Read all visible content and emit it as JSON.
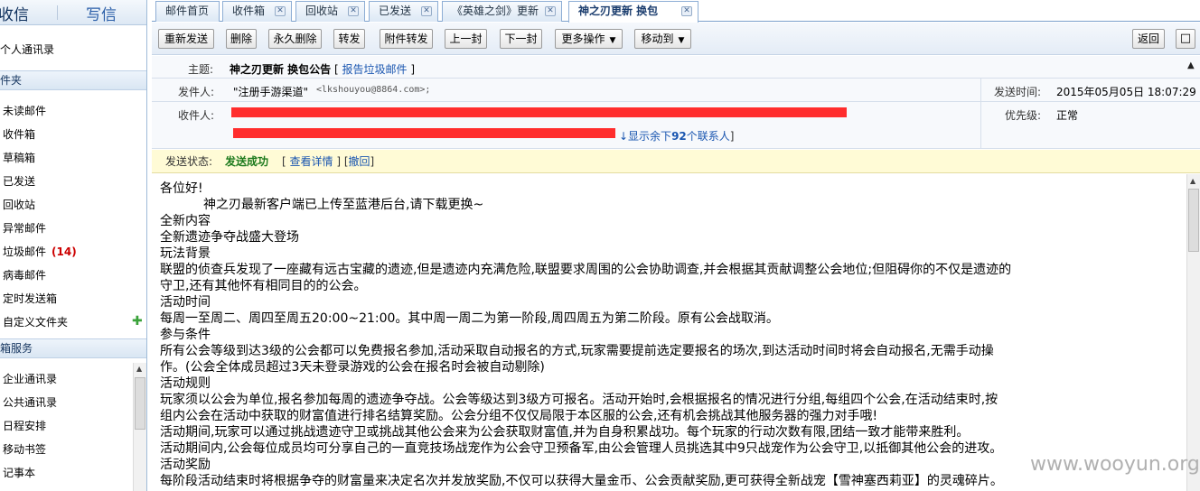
{
  "sidebar": {
    "receive": "收信",
    "write": "写信",
    "contacts": "个人通讯录",
    "folders_header": "件夹",
    "folders": [
      {
        "label": "未读邮件"
      },
      {
        "label": "收件箱"
      },
      {
        "label": "草稿箱"
      },
      {
        "label": "已发送"
      },
      {
        "label": "回收站"
      },
      {
        "label": "异常邮件"
      },
      {
        "label": "垃圾邮件",
        "count": "(14)"
      },
      {
        "label": "病毒邮件"
      },
      {
        "label": "定时发送箱"
      },
      {
        "label": "自定义文件夹"
      }
    ],
    "services_header": "箱服务",
    "services": [
      {
        "label": "企业通讯录"
      },
      {
        "label": "公共通讯录"
      },
      {
        "label": "日程安排"
      },
      {
        "label": "移动书签"
      },
      {
        "label": "记事本"
      }
    ]
  },
  "tabs": [
    {
      "label": "邮件首页"
    },
    {
      "label": "收件箱"
    },
    {
      "label": "回收站"
    },
    {
      "label": "已发送"
    },
    {
      "label": "《英雄之剑》更新"
    },
    {
      "label": "神之刃更新 换包"
    }
  ],
  "toolbar": {
    "resend": "重新发送",
    "delete": "删除",
    "delete_forever": "永久删除",
    "forward": "转发",
    "forward_attachment": "附件转发",
    "prev": "上一封",
    "next": "下一封",
    "more": "更多操作",
    "move": "移动到",
    "back": "返回"
  },
  "header": {
    "subject_label": "主题:",
    "subject": "神之刃更新 换包公告",
    "report": "报告垃圾邮件",
    "sender_label": "发件人:",
    "sender_name": "\"注册手游渠道\"",
    "sender_email": "<lkshouyou@8864.com>;",
    "time_label": "发送时间:",
    "time": "2015年05月05日 18:07:29",
    "recipient_label": "收件人:",
    "priority_label": "优先级:",
    "priority": "正常",
    "show_more_prefix": "↓显示余下",
    "show_more_count": "92",
    "show_more_suffix": "个联系人"
  },
  "status": {
    "label": "发送状态:",
    "value": "发送成功",
    "detail": "查看详情",
    "undo": "撤回"
  },
  "body": {
    "lines": [
      "各位好!",
      "神之刃最新客户端已上传至蓝港后台,请下载更换~",
      "全新内容",
      "全新遗迹争夺战盛大登场",
      "玩法背景",
      "联盟的侦查兵发现了一座藏有远古宝藏的遗迹,但是遗迹内充满危险,联盟要求周围的公会协助调查,并会根据其贡献调整公会地位;但阻碍你的不仅是遗迹的",
      "守卫,还有其他怀有相同目的的公会。",
      "活动时间",
      "每周一至周二、周四至周五20:00~21:00。其中周一周二为第一阶段,周四周五为第二阶段。原有公会战取消。",
      "参与条件",
      "所有公会等级到达3级的公会都可以免费报名参加,活动采取自动报名的方式,玩家需要提前选定要报名的场次,到达活动时间时将会自动报名,无需手动操",
      "作。(公会全体成员超过3天未登录游戏的公会在报名时会被自动剔除)",
      "活动规则",
      "玩家须以公会为单位,报名参加每周的遗迹争夺战。公会等级达到3级方可报名。活动开始时,会根据报名的情况进行分组,每组四个公会,在活动结束时,按",
      "组内公会在活动中获取的财富值进行排名结算奖励。公会分组不仅仅局限于本区服的公会,还有机会挑战其他服务器的强力对手哦!",
      "活动期间,玩家可以通过挑战遗迹守卫或挑战其他公会来为公会获取财富值,并为自身积累战功。每个玩家的行动次数有限,团结一致才能带来胜利。",
      "活动期间内,公会每位成员均可分享自己的一直竞技场战宠作为公会守卫预备军,由公会管理人员挑选其中9只战宠作为公会守卫,以抵御其他公会的进攻。",
      "活动奖励",
      "每阶段活动结束时将根据争夺的财富量来决定名次并发放奖励,不仅可以获得大量金币、公会贡献奖励,更可获得全新战宠【雪神塞西莉亚】的灵魂碎片。"
    ]
  },
  "watermark": "www.wooyun.org"
}
